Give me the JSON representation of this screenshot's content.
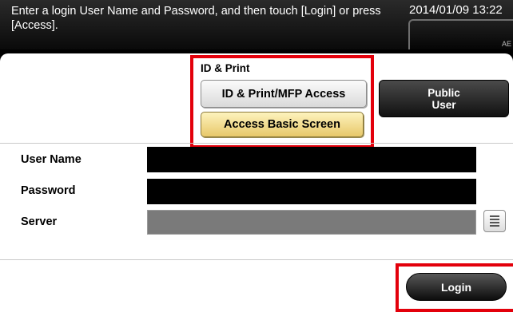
{
  "header": {
    "message": "Enter a login User Name and Password, and then touch [Login] or press [Access].",
    "datetime": "2014/01/09 13:22",
    "box_icon": "AE"
  },
  "auth": {
    "group_label": "ID & Print",
    "id_print_button": "ID & Print/MFP Access",
    "basic_screen_button": "Access Basic Screen",
    "public_user_button_line1": "Public",
    "public_user_button_line2": "User"
  },
  "form": {
    "user_name_label": "User Name",
    "user_name_value": "",
    "password_label": "Password",
    "password_value": "",
    "server_label": "Server",
    "server_value": ""
  },
  "footer": {
    "login_button": "Login"
  },
  "colors": {
    "highlight_frame": "#e3000b",
    "basic_screen_button": "#f3dc8a",
    "server_field": "#7a7a7a"
  },
  "icons": {
    "server_list": "list-icon"
  }
}
